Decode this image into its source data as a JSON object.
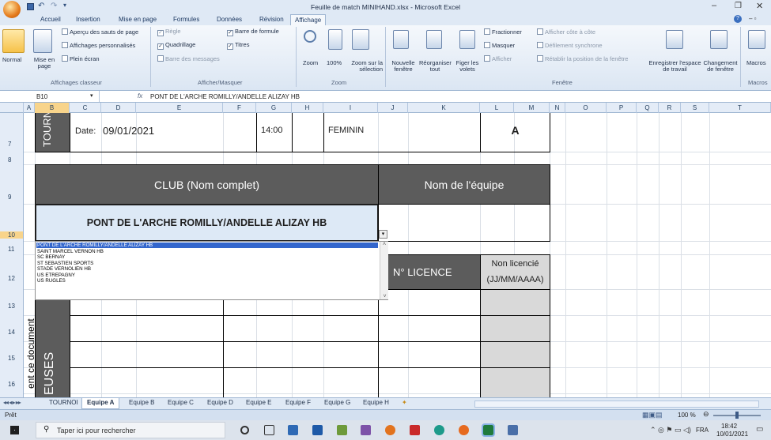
{
  "window": {
    "title": "Feuille de match MINIHAND.xlsx - Microsoft Excel"
  },
  "ribbon_tabs": [
    "Accueil",
    "Insertion",
    "Mise en page",
    "Formules",
    "Données",
    "Révision",
    "Affichage"
  ],
  "ribbon": {
    "normal": "Normal",
    "mise_en_page": "Mise en page",
    "apercu": "Aperçu des sauts de page",
    "affichages_perso": "Affichages personnalisés",
    "plein_ecran": "Plein écran",
    "grp_affichages": "Affichages classeur",
    "regle": "Règle",
    "quadrillage": "Quadrillage",
    "barre_messages": "Barre des messages",
    "barre_formule": "Barre de formule",
    "titres": "Titres",
    "grp_afficher": "Afficher/Masquer",
    "zoom": "Zoom",
    "zoom100": "100%",
    "zoom_selection": "Zoom sur la sélection",
    "grp_zoom": "Zoom",
    "nouvelle_fenetre": "Nouvelle fenêtre",
    "reorganiser": "Réorganiser tout",
    "figer": "Figer les volets",
    "fractionner": "Fractionner",
    "masquer": "Masquer",
    "afficher": "Afficher",
    "cote_a_cote": "Afficher côte à côte",
    "defilement": "Défilement synchrone",
    "retablir": "Rétablir la position de la fenêtre",
    "grp_fenetre": "Fenêtre",
    "enregistrer": "Enregistrer l'espace de travail",
    "changement": "Changement de fenêtre",
    "macros": "Macros",
    "grp_macros": "Macros"
  },
  "formula_bar": {
    "name_box": "B10",
    "fx": "fx",
    "content": "PONT DE L'ARCHE ROMILLY/ANDELLE ALIZAY HB"
  },
  "columns": [
    "A",
    "B",
    "C",
    "D",
    "E",
    "F",
    "G",
    "H",
    "I",
    "J",
    "K",
    "L",
    "M",
    "N",
    "O",
    "P",
    "Q",
    "R",
    "S",
    "T"
  ],
  "rows": [
    "7",
    "8",
    "9",
    "10",
    "11",
    "12",
    "13",
    "14",
    "15",
    "16"
  ],
  "sheet": {
    "tournoi_vertical": "TOURNOI",
    "date_label": "Date:",
    "date_value": "09/01/2021",
    "time_value": "14:00",
    "category": "FEMININ",
    "team_letter": "A",
    "club_header": "CLUB (Nom complet)",
    "team_name_header": "Nom de l'équipe",
    "club_value": "PONT DE L'ARCHE ROMILLY/ANDELLE ALIZAY HB",
    "licence_header": "N° LICENCE",
    "non_licencie_header": "Non licencié",
    "non_licencie_sub": "(JJ/MM/AAAA)",
    "vertical_document": "ent ce document",
    "vertical_euses": "EUSES"
  },
  "dropdown_options": [
    "PONT DE L'ARCHE ROMILLY/ANDELLE ALIZAY HB",
    "SAINT MARCEL VERNON HB",
    "SC BERNAY",
    "ST SEBASTIEN SPORTS",
    "STADE VERNOLIEN HB",
    "US ETREPAGNY",
    "US RUGLES"
  ],
  "sheet_tabs": [
    "TOURNOI",
    "Equipe A",
    "Equipe B",
    "Equipe C",
    "Equipe D",
    "Equipe E",
    "Equipe F",
    "Equipe G",
    "Equipe H"
  ],
  "status": {
    "ready": "Prêt",
    "zoom": "100 %"
  },
  "taskbar": {
    "search": "Taper ici pour rechercher",
    "lang": "FRA",
    "time": "18:42",
    "date": "10/01/2021"
  },
  "colors": {
    "dark_header": "#5c5c5c",
    "selected_option": "#3366cc",
    "club_fill": "#dde9f6"
  }
}
